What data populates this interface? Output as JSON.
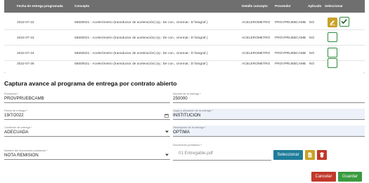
{
  "table": {
    "headers": [
      "Fecha de entrega programada",
      "Concepto",
      "Detalle concepto",
      "Proveedor",
      "Aplicado",
      "Seleccionar"
    ],
    "rows": [
      {
        "fecha": "2022-07-22",
        "concepto": "56500021 - Acelerómetro (transductor de aceleración) (ej.: De con., cinemat.: D fotograf.)",
        "detalle": "ACELEROMETRO",
        "proveedor": "PROVPRUEBCAMB",
        "aplicado": "NO",
        "selected": true
      },
      {
        "fecha": "2022-07-23",
        "concepto": "56500021 - Acelerómetro (transductor de aceleración) (ej.: De con., cinemat.: D fotograf.)",
        "detalle": "ACELEROMETRO",
        "proveedor": "PROVPRUEBCAMB",
        "aplicado": "NO",
        "selected": false
      },
      {
        "fecha": "2022-07-24",
        "concepto": "56500021 - Acelerómetro (transductor de aceleración) (ej.: De con., cinemat.: D fotograf.)",
        "detalle": "ACELEROMETRO",
        "proveedor": "PROVPRUEBCAMB",
        "aplicado": "NO",
        "selected": false
      },
      {
        "fecha": "2022-07-26",
        "concepto": "56500021 - Acelerómetro (transductor de aceleración) (ej.: De con., cinemat.: D fotograf.)",
        "detalle": "ACELEROMETRO",
        "proveedor": "PROVPRUEBCAMB",
        "aplicado": "NO",
        "selected": false
      }
    ]
  },
  "scroll": {
    "left": "‹",
    "right": "›"
  },
  "section_title": "Captura avance al programa de entrega por contrato abierto",
  "form": {
    "proveedor": {
      "label": "Proveedor *",
      "value": "PROVPRUEBCAMB"
    },
    "importe": {
      "label": "Importe de la entrega *",
      "value": "250000"
    },
    "fecha": {
      "label": "Fecha de entrega *",
      "value": "19/7/2022"
    },
    "lugar": {
      "label": "Lugar y ubicación de la entrega *",
      "value": "INSTITUCION"
    },
    "condicion": {
      "label": "Condición de entrega *",
      "value": "ADECUADA"
    },
    "descripcion": {
      "label": "Descripción de la entrega *",
      "value": "OPTIMA"
    },
    "nombre_doc": {
      "label": "Nombre del documento probatorio *",
      "value": "NOTA REMISION"
    },
    "doc_probatorio": {
      "label": "Documento probatorio *",
      "value": "01 Entregable.pdf"
    }
  },
  "buttons": {
    "seleccionar": "Seleccionar",
    "cancelar": "Cancelar",
    "guardar": "Guardar"
  },
  "colors": {
    "header_bg": "#6f6f6f",
    "edit_button": "#c9a227",
    "check_border": "#2e8b3e",
    "primary": "#1f7c9a",
    "danger": "#c0392b",
    "success": "#3a9a3f"
  }
}
